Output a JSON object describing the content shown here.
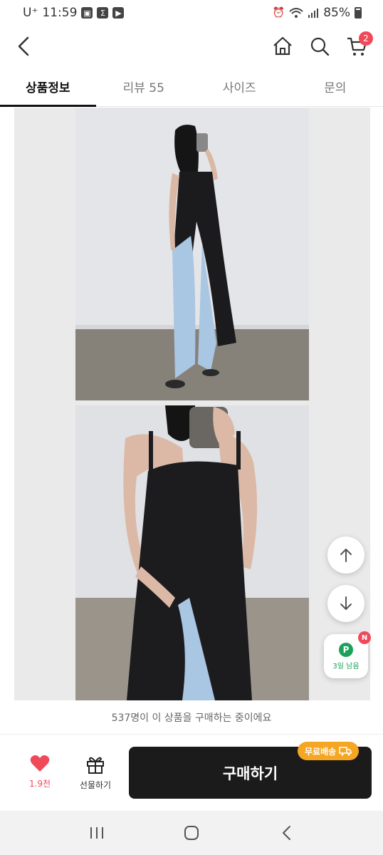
{
  "status_bar": {
    "carrier": "U⁺",
    "time": "11:59",
    "battery": "85%"
  },
  "header": {
    "cart_count": "2"
  },
  "tabs": [
    {
      "label": "상품정보",
      "active": true
    },
    {
      "label": "리뷰 55",
      "active": false
    },
    {
      "label": "사이즈",
      "active": false
    },
    {
      "label": "문의",
      "active": false
    }
  ],
  "floating": {
    "point_label": "P",
    "point_text": "3일 남음",
    "new_badge": "N"
  },
  "purchase_banner": "537명이 이 상품을 구매하는 중이에요",
  "action_bar": {
    "like_count": "1.9천",
    "gift_label": "선물하기",
    "buy_label": "구매하기",
    "free_shipping": "무료배송"
  },
  "colors": {
    "accent_red": "#f04a5a",
    "buy_button": "#1b1b1b",
    "free_shipping_badge": "#f5a623",
    "point_green": "#1aa15a"
  }
}
